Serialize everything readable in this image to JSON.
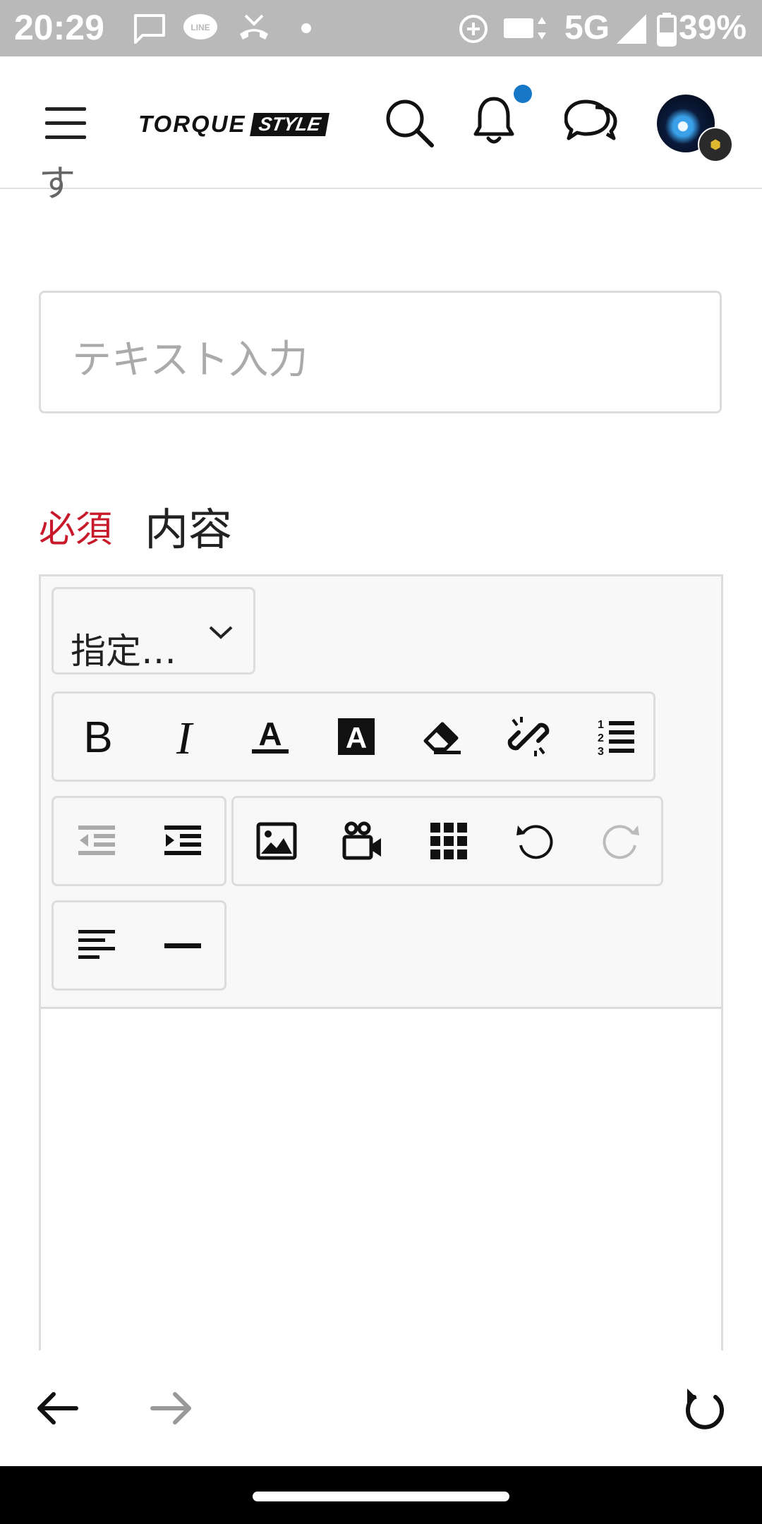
{
  "status_bar": {
    "time": "20:29",
    "network": "5G",
    "battery": "39%",
    "icons": [
      "message-icon",
      "line-icon",
      "missed-call-icon",
      "dot-icon",
      "data-saver-icon",
      "sim-icon",
      "signal-icon",
      "battery-icon"
    ]
  },
  "header": {
    "logo_main": "TORQUE",
    "logo_badge": "STYLE",
    "icons": [
      "menu-icon",
      "search-icon",
      "bell-icon",
      "chat-icon"
    ],
    "notification_dot_color": "#1878c8",
    "avatar_badge": "TORQUE"
  },
  "content": {
    "cut_text": "す",
    "text_input": {
      "placeholder": "テキスト入力",
      "value": ""
    },
    "required_label": "必須",
    "field_label": "内容",
    "required_color": "#c8192a"
  },
  "editor": {
    "format_select": "指定…",
    "toolbar_row1": [
      "bold-icon",
      "italic-icon",
      "font-color-icon",
      "background-color-icon",
      "eraser-icon",
      "unlink-icon",
      "ordered-list-icon"
    ],
    "toolbar_row2_a": [
      "outdent-icon",
      "indent-icon"
    ],
    "toolbar_row2_b": [
      "image-icon",
      "video-icon",
      "table-icon",
      "undo-icon",
      "redo-icon"
    ],
    "toolbar_row3": [
      "align-left-icon",
      "horizontal-rule-icon"
    ]
  },
  "bottom_bar": {
    "icons": [
      "back-arrow-icon",
      "forward-arrow-icon",
      "refresh-icon"
    ]
  }
}
